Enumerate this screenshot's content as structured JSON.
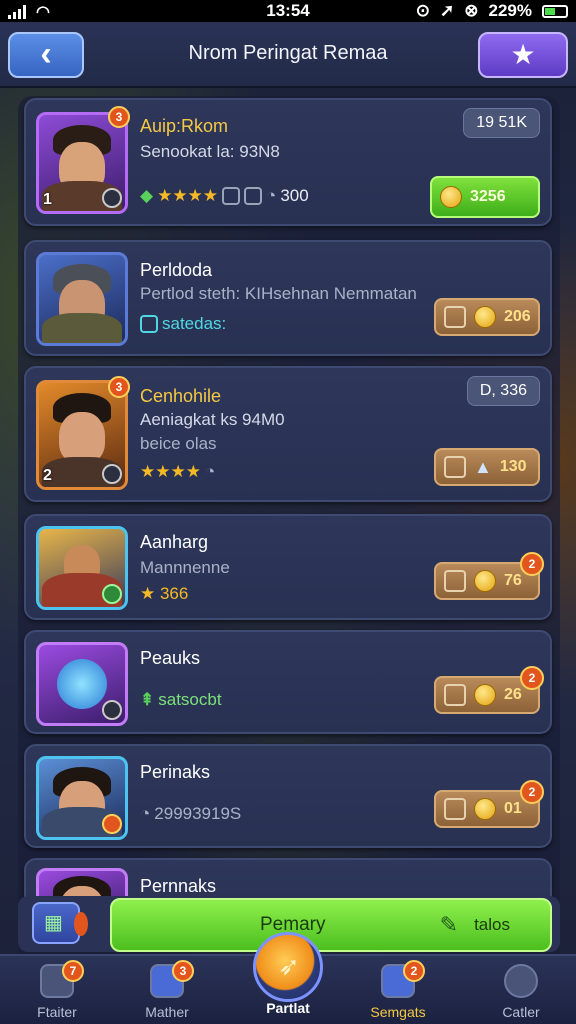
{
  "status_bar": {
    "time": "13:54",
    "battery": "229%"
  },
  "header": {
    "back_label": "‹",
    "title": "Nrom Peringat Remaa",
    "star_label": "★"
  },
  "cards": [
    {
      "name": "Auip:Rkom",
      "line1": "Senookat la: 93N8",
      "stars": "★★★★",
      "extra": "300",
      "tag": "19 51K",
      "cost": "3256",
      "corner": "1",
      "badge": "3"
    },
    {
      "name": "Perldoda",
      "line1": "Pertlod steth: KIHsehnan Nemmatan",
      "line2": "satedas:",
      "cost": "206"
    },
    {
      "name": "Cenhohile",
      "line1": "Aeniagkat ks 94M0",
      "line2": "beice olas",
      "stars": "★★★★",
      "tag": "D, 336",
      "cost": "130",
      "corner": "2",
      "badge": "3"
    },
    {
      "name": "Aanharg",
      "line1": "Mannnenne",
      "stars_text": "★ 366",
      "cost": "76",
      "pill_badge": "2"
    },
    {
      "name": "Peauks",
      "line1": "satsocbt",
      "cost": "26",
      "pill_badge": "2"
    },
    {
      "name": "Perinaks",
      "line1": "29993919S",
      "cost": "01",
      "pill_badge": "2"
    },
    {
      "name": "Pernnaks"
    }
  ],
  "action": {
    "primary": "Pemary",
    "secondary": "talos"
  },
  "tabs": [
    {
      "label": "Ftaiter",
      "badge": "7"
    },
    {
      "label": "Mather",
      "badge": "3"
    },
    {
      "label": "Partlat"
    },
    {
      "label": "Semgats",
      "badge": "2"
    },
    {
      "label": "Catler"
    }
  ],
  "colors": {
    "accent_green": "#4cbf1f",
    "gold": "#f5c843",
    "panel": "#2e375a",
    "badge": "#e2561e"
  }
}
